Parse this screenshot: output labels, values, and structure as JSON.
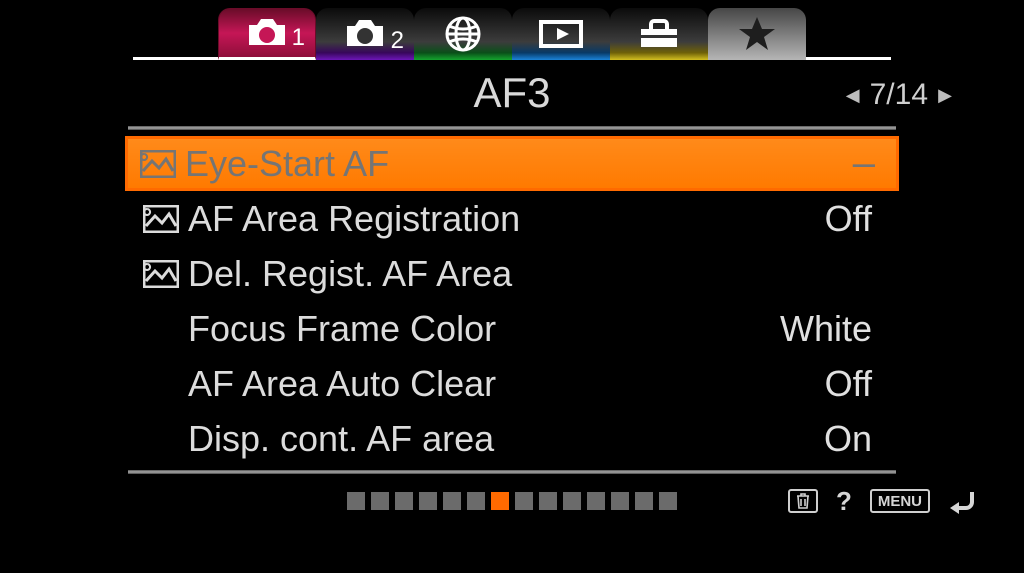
{
  "tabs": {
    "camera1_sub": "1",
    "camera2_sub": "2"
  },
  "section": {
    "title": "AF3",
    "page_current": "7",
    "page_total": "14",
    "page_display": "7/14"
  },
  "items": [
    {
      "label": "Eye-Start AF",
      "value": "–",
      "has_icon": true
    },
    {
      "label": "AF Area Registration",
      "value": "Off",
      "has_icon": true
    },
    {
      "label": "Del. Regist. AF Area",
      "value": "",
      "has_icon": true
    },
    {
      "label": "Focus Frame Color",
      "value": "White",
      "has_icon": false
    },
    {
      "label": "AF Area Auto Clear",
      "value": "Off",
      "has_icon": false
    },
    {
      "label": "Disp. cont. AF area",
      "value": "On",
      "has_icon": false
    }
  ],
  "pagedots": {
    "count": 14,
    "active_index": 6
  },
  "bottom": {
    "menu_label": "MENU"
  }
}
